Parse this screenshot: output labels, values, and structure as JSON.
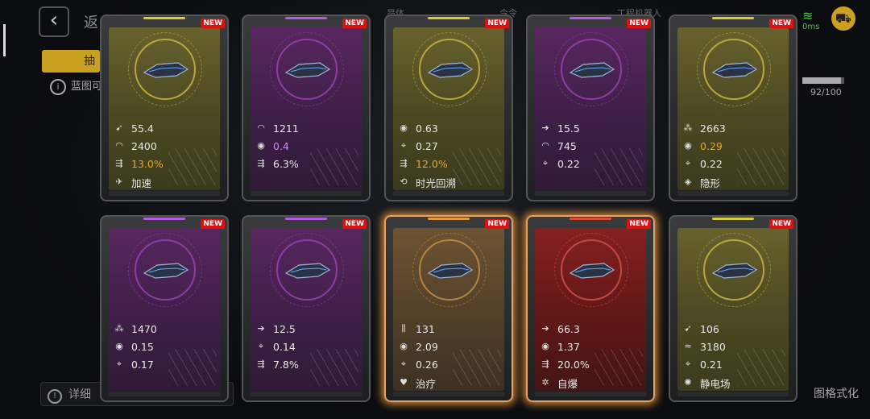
{
  "header": {
    "back_label": "返",
    "tab_label": "抽",
    "info_text": "蓝图可",
    "items": [
      "昂体",
      "令令",
      "工程机器人"
    ],
    "signal_ms": "0ms",
    "progress_value": 92,
    "progress_text": "92/100"
  },
  "bottom": {
    "details_label": "详细",
    "right_label": "图格式化"
  },
  "colors": {
    "stat_yellow": "#e6a62a",
    "stat_purple": "#cf88ff",
    "new_badge": "#dd1111"
  },
  "cards": [
    {
      "rarity": "yellow",
      "new": "NEW",
      "glow": false,
      "stats": [
        {
          "icon": "speed-icon",
          "value": "55.4",
          "color": ""
        },
        {
          "icon": "shield-arc-icon",
          "value": "2400",
          "color": ""
        },
        {
          "icon": "evade-icon",
          "value": "13.0%",
          "color": "yellow"
        },
        {
          "icon": "skill-boost-icon",
          "value": "加速",
          "color": ""
        }
      ]
    },
    {
      "rarity": "purple",
      "new": "NEW",
      "glow": false,
      "stats": [
        {
          "icon": "shield-arc-icon",
          "value": "1211",
          "color": ""
        },
        {
          "icon": "target-circle-icon",
          "value": "0.4",
          "color": "purple"
        },
        {
          "icon": "evade-icon",
          "value": "6.3%",
          "color": ""
        }
      ]
    },
    {
      "rarity": "yellow",
      "new": "NEW",
      "glow": false,
      "stats": [
        {
          "icon": "target-circle-icon",
          "value": "0.63",
          "color": ""
        },
        {
          "icon": "crosshair-icon",
          "value": "0.27",
          "color": ""
        },
        {
          "icon": "evade-icon",
          "value": "12.0%",
          "color": "yellow"
        },
        {
          "icon": "time-rewind-icon",
          "value": "时光回溯",
          "color": ""
        }
      ]
    },
    {
      "rarity": "purple",
      "new": "NEW",
      "glow": false,
      "stats": [
        {
          "icon": "arrow-right-icon",
          "value": "15.5",
          "color": ""
        },
        {
          "icon": "shield-arc-icon",
          "value": "745",
          "color": ""
        },
        {
          "icon": "crosshair-icon",
          "value": "0.22",
          "color": ""
        }
      ]
    },
    {
      "rarity": "yellow",
      "new": "NEW",
      "glow": false,
      "stats": [
        {
          "icon": "cluster-icon",
          "value": "2663",
          "color": ""
        },
        {
          "icon": "target-circle-icon",
          "value": "0.29",
          "color": "yellow"
        },
        {
          "icon": "crosshair-icon",
          "value": "0.22",
          "color": ""
        },
        {
          "icon": "stealth-icon",
          "value": "隐形",
          "color": ""
        }
      ]
    },
    {
      "rarity": "purple",
      "new": "NEW",
      "glow": false,
      "stats": [
        {
          "icon": "cluster-icon",
          "value": "1470",
          "color": ""
        },
        {
          "icon": "target-circle-icon",
          "value": "0.15",
          "color": ""
        },
        {
          "icon": "crosshair-icon",
          "value": "0.17",
          "color": ""
        }
      ]
    },
    {
      "rarity": "purple",
      "new": "NEW",
      "glow": false,
      "stats": [
        {
          "icon": "arrow-right-icon",
          "value": "12.5",
          "color": ""
        },
        {
          "icon": "crosshair-icon",
          "value": "0.14",
          "color": ""
        },
        {
          "icon": "evade-icon",
          "value": "7.8%",
          "color": ""
        }
      ]
    },
    {
      "rarity": "orange",
      "new": "NEW",
      "glow": true,
      "stats": [
        {
          "icon": "bars-icon",
          "value": "131",
          "color": ""
        },
        {
          "icon": "target-circle-icon",
          "value": "2.09",
          "color": ""
        },
        {
          "icon": "crosshair-icon",
          "value": "0.26",
          "color": ""
        },
        {
          "icon": "heal-icon",
          "value": "治疗",
          "color": ""
        }
      ]
    },
    {
      "rarity": "red",
      "new": "NEW",
      "glow": true,
      "stats": [
        {
          "icon": "arrow-right-icon",
          "value": "66.3",
          "color": ""
        },
        {
          "icon": "target-circle-icon",
          "value": "1.37",
          "color": ""
        },
        {
          "icon": "evade-icon",
          "value": "20.0%",
          "color": ""
        },
        {
          "icon": "self-destruct-icon",
          "value": "自爆",
          "color": ""
        }
      ]
    },
    {
      "rarity": "yellow",
      "new": "NEW",
      "glow": false,
      "stats": [
        {
          "icon": "speed-icon",
          "value": "106",
          "color": ""
        },
        {
          "icon": "wave-icon",
          "value": "3180",
          "color": ""
        },
        {
          "icon": "crosshair-icon",
          "value": "0.21",
          "color": ""
        },
        {
          "icon": "static-field-icon",
          "value": "静电场",
          "color": ""
        }
      ]
    }
  ]
}
